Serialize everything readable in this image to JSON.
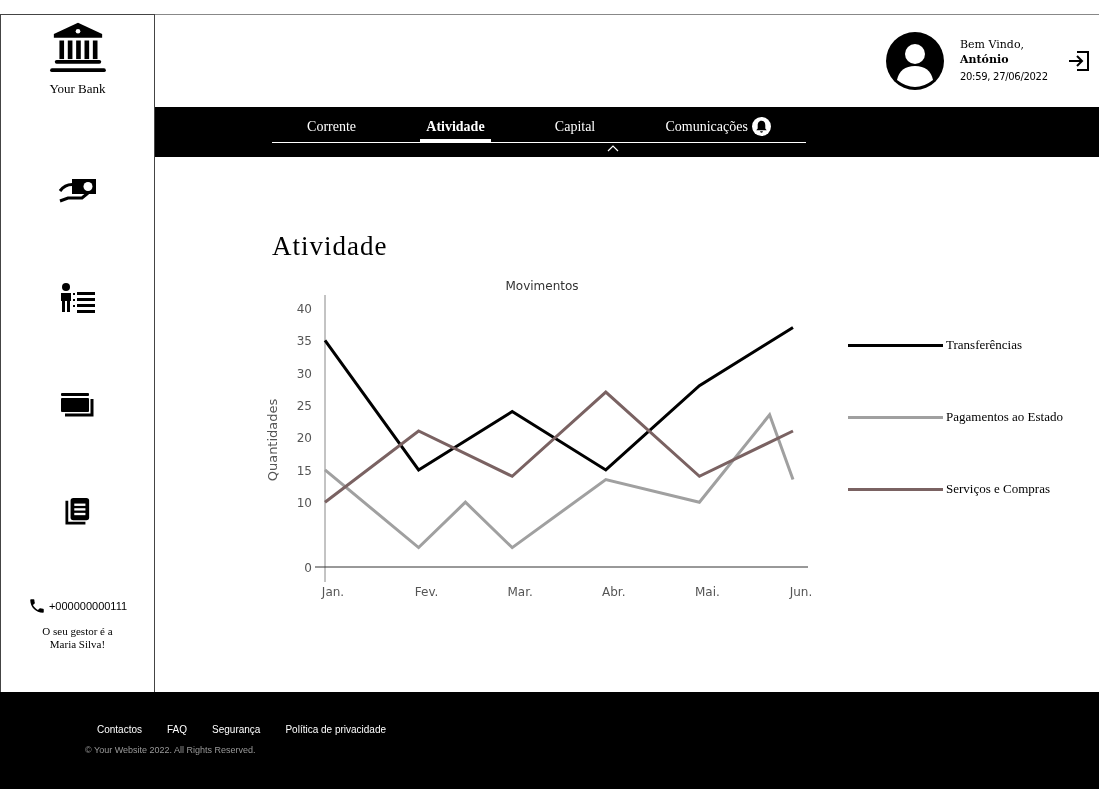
{
  "sidebar": {
    "logo": "Your Bank",
    "phone": "+000000000111",
    "manager_note": "O seu gestor é a Maria Silva!"
  },
  "header": {
    "greeting": "Bem Vindo,",
    "user": "António",
    "datetime": "20:59, 27/06/2022"
  },
  "tabs": [
    {
      "label": "Corrente",
      "selected": false,
      "notification": false
    },
    {
      "label": "Atividade",
      "selected": true,
      "notification": false
    },
    {
      "label": "Capital",
      "selected": false,
      "notification": false
    },
    {
      "label": "Comunicações",
      "selected": false,
      "notification": true
    }
  ],
  "page_title": "Atividade",
  "chart_data": {
    "type": "line",
    "title": "Movimentos",
    "ylabel": "Quantidades",
    "categories": [
      "Jan.",
      null,
      null,
      null,
      "Fev.",
      null,
      null,
      null,
      "Mar.",
      null,
      null,
      null,
      "Abr.",
      null,
      null,
      null,
      "Mai.",
      null,
      null,
      null,
      "Jun."
    ],
    "yticks": [
      0,
      10,
      15,
      20,
      25,
      30,
      35,
      40
    ],
    "ylim": [
      0,
      42
    ],
    "series": [
      {
        "name": "Transferências",
        "color": "#000000",
        "values": [
          35,
          null,
          null,
          null,
          15,
          null,
          null,
          null,
          24,
          null,
          null,
          null,
          15,
          null,
          null,
          null,
          28,
          null,
          null,
          null,
          37
        ]
      },
      {
        "name": "Pagamentos ao Estado",
        "color": "#a0a0a0",
        "values": [
          15,
          null,
          null,
          null,
          3,
          null,
          10,
          null,
          3,
          null,
          null,
          null,
          13.5,
          null,
          null,
          null,
          10,
          null,
          null,
          23.5,
          13.5
        ]
      },
      {
        "name": "Serviços e Compras",
        "color": "#7a6262",
        "values": [
          10,
          null,
          null,
          null,
          21,
          null,
          null,
          null,
          14,
          null,
          null,
          null,
          27,
          null,
          null,
          null,
          14,
          null,
          null,
          null,
          21
        ]
      }
    ]
  },
  "footer": {
    "links": [
      "Contactos",
      "FAQ",
      "Segurança",
      "Política de privacidade"
    ],
    "copyright": "© Your Website 2022. All Rights Reserved."
  }
}
